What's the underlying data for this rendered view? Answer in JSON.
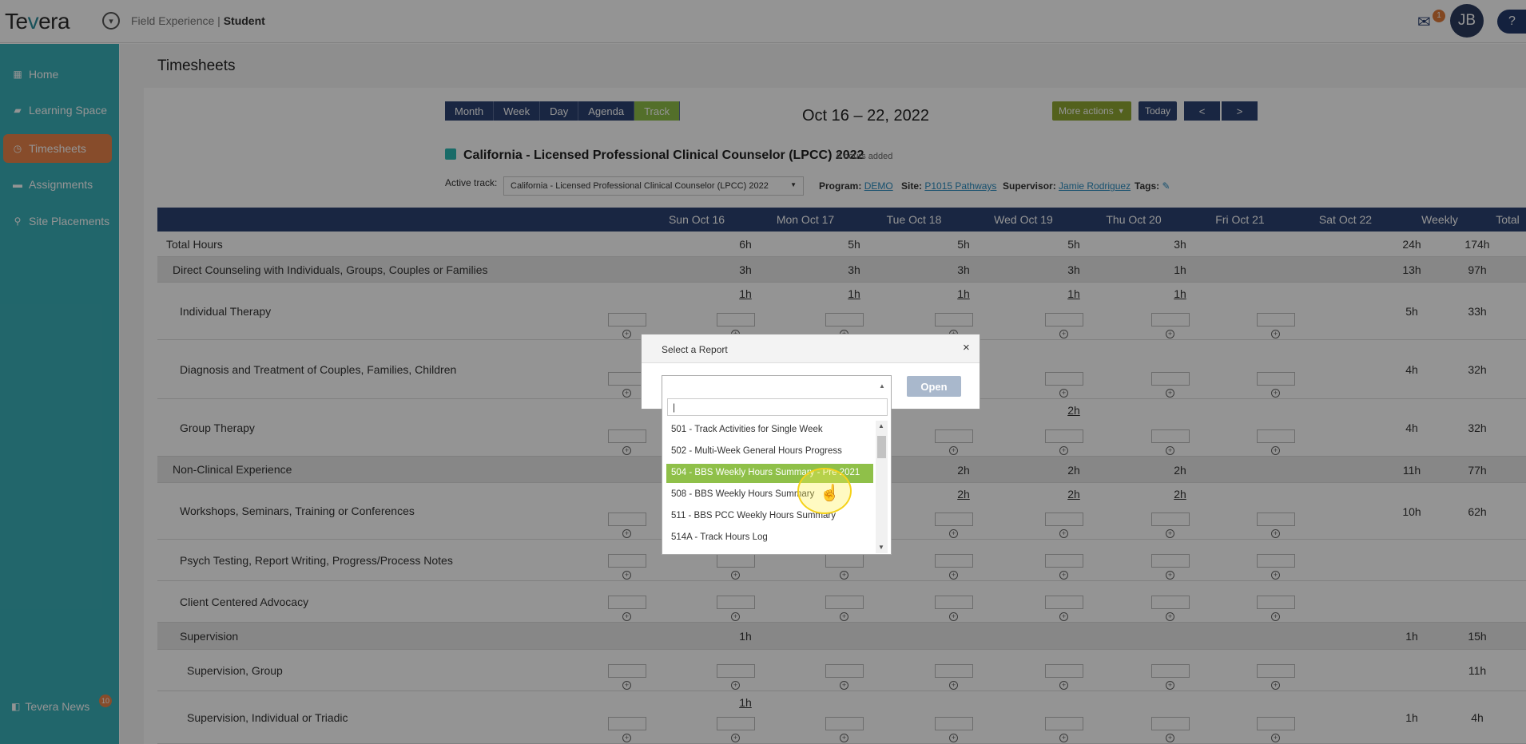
{
  "app": {
    "logo_pre": "Te",
    "logo_v": "v",
    "logo_post": "era",
    "context_label": "Field Experience | ",
    "context_role": "Student",
    "mail_count": "1",
    "avatar_initials": "JB",
    "help_label": "?"
  },
  "sidebar": {
    "items": [
      {
        "label": "Home",
        "icon": "grid-icon"
      },
      {
        "label": "Learning Space",
        "icon": "cap-icon"
      },
      {
        "label": "Timesheets",
        "icon": "clock-icon"
      },
      {
        "label": "Assignments",
        "icon": "folder-icon"
      },
      {
        "label": "Site Placements",
        "icon": "pin-icon"
      }
    ],
    "news_label": "Tevera News",
    "news_count": "10"
  },
  "page": {
    "title": "Timesheets"
  },
  "views": [
    "Month",
    "Week",
    "Day",
    "Agenda",
    "Track"
  ],
  "date_range": "Oct 16 – 22, 2022",
  "actions": {
    "more": "More actions",
    "today": "Today",
    "prev": "<",
    "next": ">"
  },
  "track": {
    "title": "California - Licensed Professional Clinical Counselor (LPCC) 2022",
    "hours_added": "0 hours added",
    "active_label": "Active track:",
    "active_value": "California - Licensed Professional Clinical Counselor (LPCC) 2022",
    "program_label": "Program:",
    "program_value": "DEMO",
    "site_label": "Site:",
    "site_value": "P1015 Pathways",
    "supervisor_label": "Supervisor:",
    "supervisor_value": "Jamie Rodriguez",
    "tags_label": "Tags:"
  },
  "table": {
    "headers": [
      "Sun Oct 16",
      "Mon Oct 17",
      "Tue Oct 18",
      "Wed Oct 19",
      "Thu Oct 20",
      "Fri Oct 21",
      "Sat Oct 22",
      "Weekly",
      "Total"
    ],
    "rows": [
      {
        "label": "Total Hours",
        "cells": [
          "",
          "6h",
          "5h",
          "5h",
          "5h",
          "3h",
          ""
        ],
        "weekly": "24h",
        "total": "174h"
      },
      {
        "label": "Direct Counseling with Individuals, Groups, Couples or Families",
        "cells": [
          "",
          "3h",
          "3h",
          "3h",
          "3h",
          "1h",
          ""
        ],
        "weekly": "13h",
        "total": "97h"
      },
      {
        "label": "Individual Therapy",
        "cells": [
          "",
          "1h",
          "1h",
          "1h",
          "1h",
          "1h",
          ""
        ],
        "weekly": "5h",
        "total": "33h"
      },
      {
        "label": "Diagnosis and Treatment of Couples, Families, Children",
        "cells": [
          "",
          "",
          "",
          "2h",
          "",
          "",
          ""
        ],
        "weekly": "4h",
        "total": "32h"
      },
      {
        "label": "Group Therapy",
        "cells": [
          "",
          "",
          "2h",
          "",
          "2h",
          "",
          ""
        ],
        "weekly": "4h",
        "total": "32h"
      },
      {
        "label": "Non-Clinical Experience",
        "cells": [
          "",
          "",
          "2h",
          "2h",
          "2h",
          "2h",
          ""
        ],
        "weekly": "11h",
        "total": "77h"
      },
      {
        "label": "Workshops, Seminars, Training or Conferences",
        "cells": [
          "",
          "",
          "2h",
          "2h",
          "2h",
          "2h",
          ""
        ],
        "weekly": "10h",
        "total": "62h"
      },
      {
        "label": "Psych Testing, Report Writing, Progress/Process Notes",
        "cells": [
          "",
          "",
          "",
          "",
          "",
          "",
          ""
        ],
        "weekly": "",
        "total": ""
      },
      {
        "label": "Client Centered Advocacy",
        "cells": [
          "",
          "",
          "",
          "",
          "",
          "",
          ""
        ],
        "weekly": "",
        "total": ""
      },
      {
        "label": "Supervision",
        "cells": [
          "",
          "1h",
          "",
          "",
          "",
          "",
          ""
        ],
        "weekly": "1h",
        "total": "15h"
      },
      {
        "label": "Supervision, Group",
        "cells": [
          "",
          "",
          "",
          "",
          "",
          "",
          ""
        ],
        "weekly": "",
        "total": "11h"
      },
      {
        "label": "Supervision, Individual or Triadic",
        "cells": [
          "",
          "1h",
          "",
          "",
          "",
          "",
          ""
        ],
        "weekly": "1h",
        "total": "4h"
      }
    ]
  },
  "modal": {
    "title": "Select a Report",
    "close": "×",
    "open_label": "Open",
    "search_value": "",
    "options": [
      "501 - Track Activities for Single Week",
      "502 - Multi-Week General Hours Progress",
      "504 - BBS Weekly Hours Summary - Pre 2021",
      "508 - BBS Weekly Hours Summary",
      "511 - BBS PCC Weekly Hours Summary",
      "514A - Track Hours Log"
    ],
    "highlighted": "504 - BBS Weekly Hours Summary - Pre 2021"
  },
  "colors": {
    "sidebar": "#3ab0b9",
    "active_nav": "#e8834a",
    "header": "#2c4272",
    "accent": "#8fc049"
  }
}
